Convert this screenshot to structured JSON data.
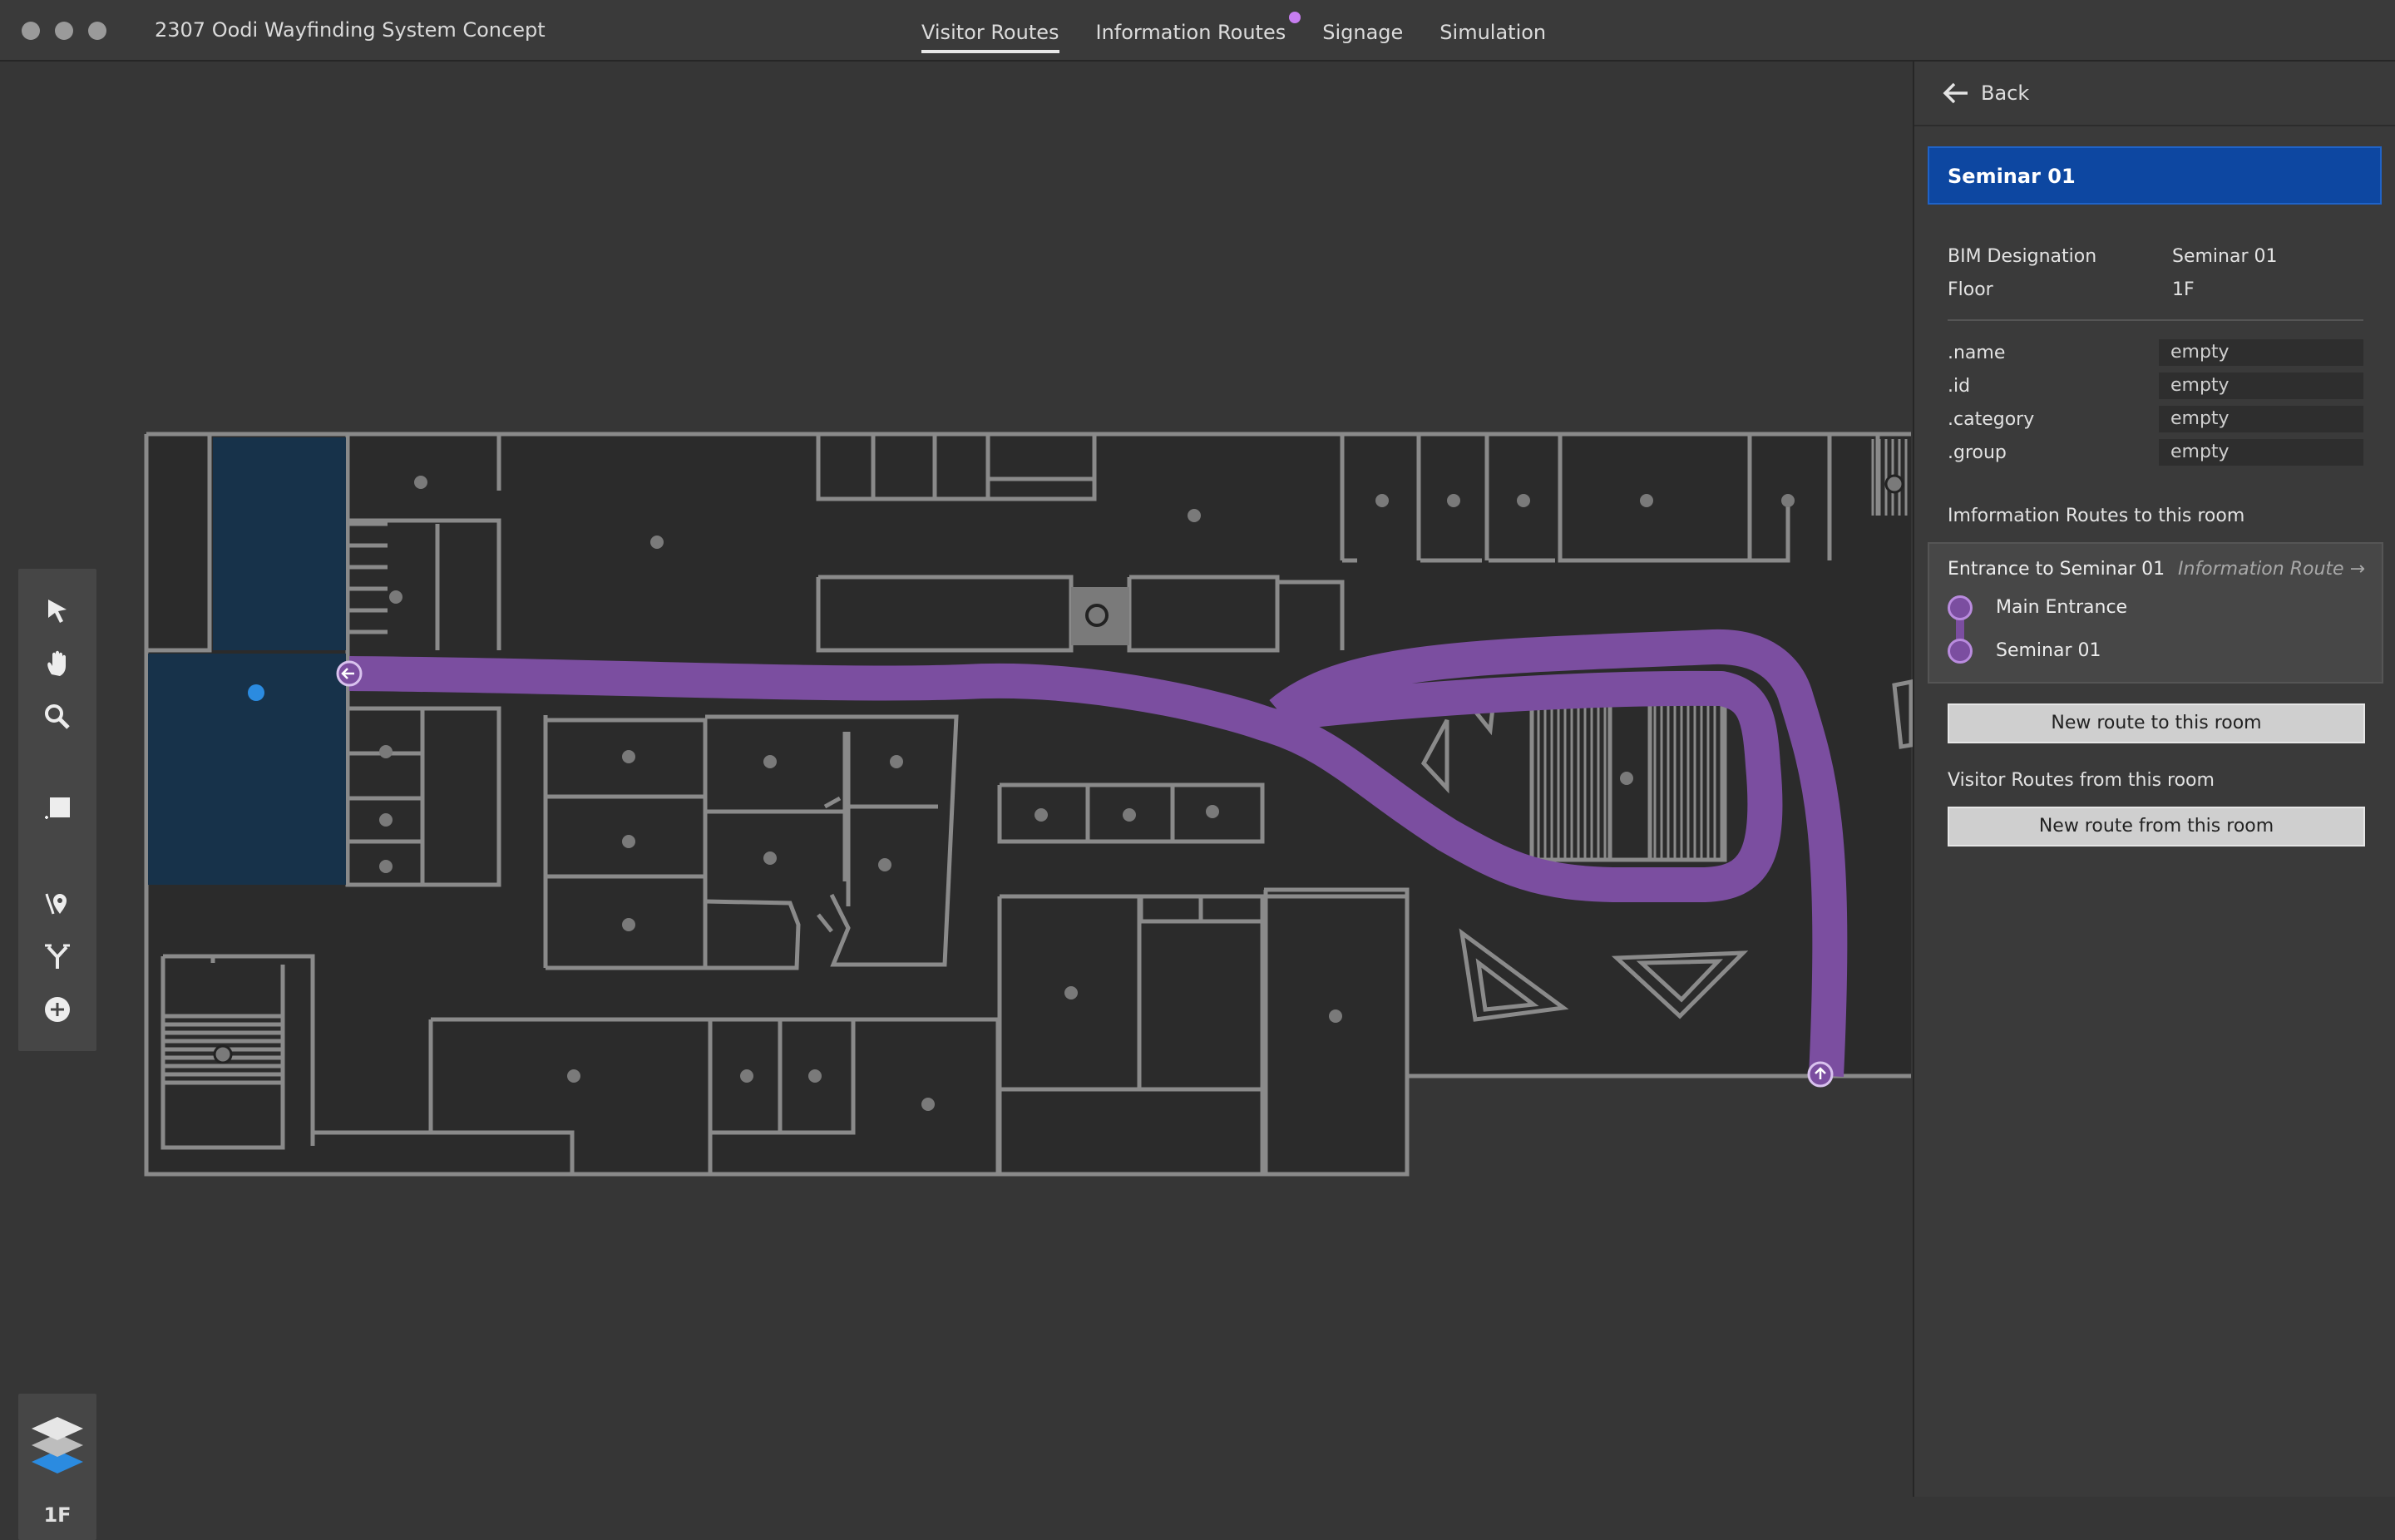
{
  "window": {
    "title": "2307 Oodi Wayfinding System Concept"
  },
  "tabs": [
    {
      "label": "Visitor Routes",
      "active": true
    },
    {
      "label": "Information Routes",
      "badge": true
    },
    {
      "label": "Signage"
    },
    {
      "label": "Simulation"
    }
  ],
  "tools": [
    "select-arrow-icon",
    "hand-pan-icon",
    "zoom-icon",
    "rectangle-icon",
    "route-pin-icon",
    "route-branch-icon",
    "add-circle-icon"
  ],
  "layers": {
    "floor_label": "1F",
    "icon": "layers-icon"
  },
  "colors": {
    "accent": "#0d47a1",
    "route": "#7b4ea0",
    "selected_room": "#17324a",
    "walls": "#8a8a8a"
  },
  "panel": {
    "back_label": "Back",
    "room_title": "Seminar 01",
    "properties": [
      {
        "key": "BIM Designation",
        "value": "Seminar 01"
      },
      {
        "key": "Floor",
        "value": "1F"
      }
    ],
    "fields": [
      {
        "key": ".name",
        "value": "empty"
      },
      {
        "key": ".id",
        "value": "empty"
      },
      {
        "key": ".category",
        "value": "empty"
      },
      {
        "key": ".group",
        "value": "empty"
      }
    ],
    "info_routes_heading": "Imformation Routes to this room",
    "route_card": {
      "title": "Entrance to Seminar 01",
      "link": "Information Route",
      "stops": [
        "Main Entrance",
        "Seminar 01"
      ]
    },
    "new_route_to_label": "New route to this room",
    "visitor_routes_heading": "Visitor Routes from this room",
    "new_route_from_label": "New route from this room"
  }
}
